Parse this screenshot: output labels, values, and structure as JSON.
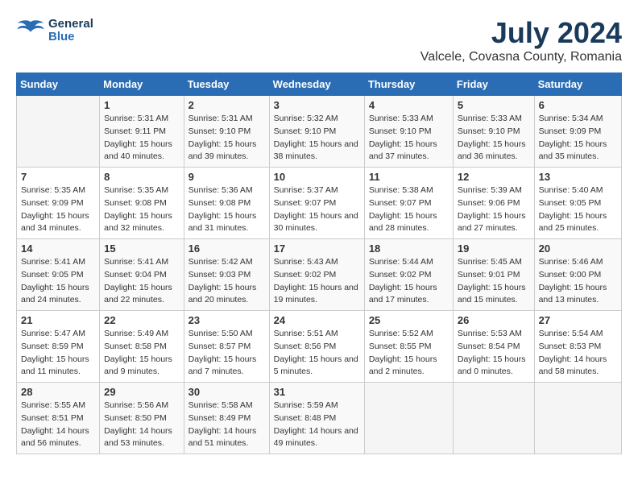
{
  "header": {
    "logo_line1": "General",
    "logo_line2": "Blue",
    "month": "July 2024",
    "location": "Valcele, Covasna County, Romania"
  },
  "weekdays": [
    "Sunday",
    "Monday",
    "Tuesday",
    "Wednesday",
    "Thursday",
    "Friday",
    "Saturday"
  ],
  "weeks": [
    [
      {
        "day": "",
        "sunrise": "",
        "sunset": "",
        "daylight": ""
      },
      {
        "day": "1",
        "sunrise": "Sunrise: 5:31 AM",
        "sunset": "Sunset: 9:11 PM",
        "daylight": "Daylight: 15 hours and 40 minutes."
      },
      {
        "day": "2",
        "sunrise": "Sunrise: 5:31 AM",
        "sunset": "Sunset: 9:10 PM",
        "daylight": "Daylight: 15 hours and 39 minutes."
      },
      {
        "day": "3",
        "sunrise": "Sunrise: 5:32 AM",
        "sunset": "Sunset: 9:10 PM",
        "daylight": "Daylight: 15 hours and 38 minutes."
      },
      {
        "day": "4",
        "sunrise": "Sunrise: 5:33 AM",
        "sunset": "Sunset: 9:10 PM",
        "daylight": "Daylight: 15 hours and 37 minutes."
      },
      {
        "day": "5",
        "sunrise": "Sunrise: 5:33 AM",
        "sunset": "Sunset: 9:10 PM",
        "daylight": "Daylight: 15 hours and 36 minutes."
      },
      {
        "day": "6",
        "sunrise": "Sunrise: 5:34 AM",
        "sunset": "Sunset: 9:09 PM",
        "daylight": "Daylight: 15 hours and 35 minutes."
      }
    ],
    [
      {
        "day": "7",
        "sunrise": "Sunrise: 5:35 AM",
        "sunset": "Sunset: 9:09 PM",
        "daylight": "Daylight: 15 hours and 34 minutes."
      },
      {
        "day": "8",
        "sunrise": "Sunrise: 5:35 AM",
        "sunset": "Sunset: 9:08 PM",
        "daylight": "Daylight: 15 hours and 32 minutes."
      },
      {
        "day": "9",
        "sunrise": "Sunrise: 5:36 AM",
        "sunset": "Sunset: 9:08 PM",
        "daylight": "Daylight: 15 hours and 31 minutes."
      },
      {
        "day": "10",
        "sunrise": "Sunrise: 5:37 AM",
        "sunset": "Sunset: 9:07 PM",
        "daylight": "Daylight: 15 hours and 30 minutes."
      },
      {
        "day": "11",
        "sunrise": "Sunrise: 5:38 AM",
        "sunset": "Sunset: 9:07 PM",
        "daylight": "Daylight: 15 hours and 28 minutes."
      },
      {
        "day": "12",
        "sunrise": "Sunrise: 5:39 AM",
        "sunset": "Sunset: 9:06 PM",
        "daylight": "Daylight: 15 hours and 27 minutes."
      },
      {
        "day": "13",
        "sunrise": "Sunrise: 5:40 AM",
        "sunset": "Sunset: 9:05 PM",
        "daylight": "Daylight: 15 hours and 25 minutes."
      }
    ],
    [
      {
        "day": "14",
        "sunrise": "Sunrise: 5:41 AM",
        "sunset": "Sunset: 9:05 PM",
        "daylight": "Daylight: 15 hours and 24 minutes."
      },
      {
        "day": "15",
        "sunrise": "Sunrise: 5:41 AM",
        "sunset": "Sunset: 9:04 PM",
        "daylight": "Daylight: 15 hours and 22 minutes."
      },
      {
        "day": "16",
        "sunrise": "Sunrise: 5:42 AM",
        "sunset": "Sunset: 9:03 PM",
        "daylight": "Daylight: 15 hours and 20 minutes."
      },
      {
        "day": "17",
        "sunrise": "Sunrise: 5:43 AM",
        "sunset": "Sunset: 9:02 PM",
        "daylight": "Daylight: 15 hours and 19 minutes."
      },
      {
        "day": "18",
        "sunrise": "Sunrise: 5:44 AM",
        "sunset": "Sunset: 9:02 PM",
        "daylight": "Daylight: 15 hours and 17 minutes."
      },
      {
        "day": "19",
        "sunrise": "Sunrise: 5:45 AM",
        "sunset": "Sunset: 9:01 PM",
        "daylight": "Daylight: 15 hours and 15 minutes."
      },
      {
        "day": "20",
        "sunrise": "Sunrise: 5:46 AM",
        "sunset": "Sunset: 9:00 PM",
        "daylight": "Daylight: 15 hours and 13 minutes."
      }
    ],
    [
      {
        "day": "21",
        "sunrise": "Sunrise: 5:47 AM",
        "sunset": "Sunset: 8:59 PM",
        "daylight": "Daylight: 15 hours and 11 minutes."
      },
      {
        "day": "22",
        "sunrise": "Sunrise: 5:49 AM",
        "sunset": "Sunset: 8:58 PM",
        "daylight": "Daylight: 15 hours and 9 minutes."
      },
      {
        "day": "23",
        "sunrise": "Sunrise: 5:50 AM",
        "sunset": "Sunset: 8:57 PM",
        "daylight": "Daylight: 15 hours and 7 minutes."
      },
      {
        "day": "24",
        "sunrise": "Sunrise: 5:51 AM",
        "sunset": "Sunset: 8:56 PM",
        "daylight": "Daylight: 15 hours and 5 minutes."
      },
      {
        "day": "25",
        "sunrise": "Sunrise: 5:52 AM",
        "sunset": "Sunset: 8:55 PM",
        "daylight": "Daylight: 15 hours and 2 minutes."
      },
      {
        "day": "26",
        "sunrise": "Sunrise: 5:53 AM",
        "sunset": "Sunset: 8:54 PM",
        "daylight": "Daylight: 15 hours and 0 minutes."
      },
      {
        "day": "27",
        "sunrise": "Sunrise: 5:54 AM",
        "sunset": "Sunset: 8:53 PM",
        "daylight": "Daylight: 14 hours and 58 minutes."
      }
    ],
    [
      {
        "day": "28",
        "sunrise": "Sunrise: 5:55 AM",
        "sunset": "Sunset: 8:51 PM",
        "daylight": "Daylight: 14 hours and 56 minutes."
      },
      {
        "day": "29",
        "sunrise": "Sunrise: 5:56 AM",
        "sunset": "Sunset: 8:50 PM",
        "daylight": "Daylight: 14 hours and 53 minutes."
      },
      {
        "day": "30",
        "sunrise": "Sunrise: 5:58 AM",
        "sunset": "Sunset: 8:49 PM",
        "daylight": "Daylight: 14 hours and 51 minutes."
      },
      {
        "day": "31",
        "sunrise": "Sunrise: 5:59 AM",
        "sunset": "Sunset: 8:48 PM",
        "daylight": "Daylight: 14 hours and 49 minutes."
      },
      {
        "day": "",
        "sunrise": "",
        "sunset": "",
        "daylight": ""
      },
      {
        "day": "",
        "sunrise": "",
        "sunset": "",
        "daylight": ""
      },
      {
        "day": "",
        "sunrise": "",
        "sunset": "",
        "daylight": ""
      }
    ]
  ]
}
